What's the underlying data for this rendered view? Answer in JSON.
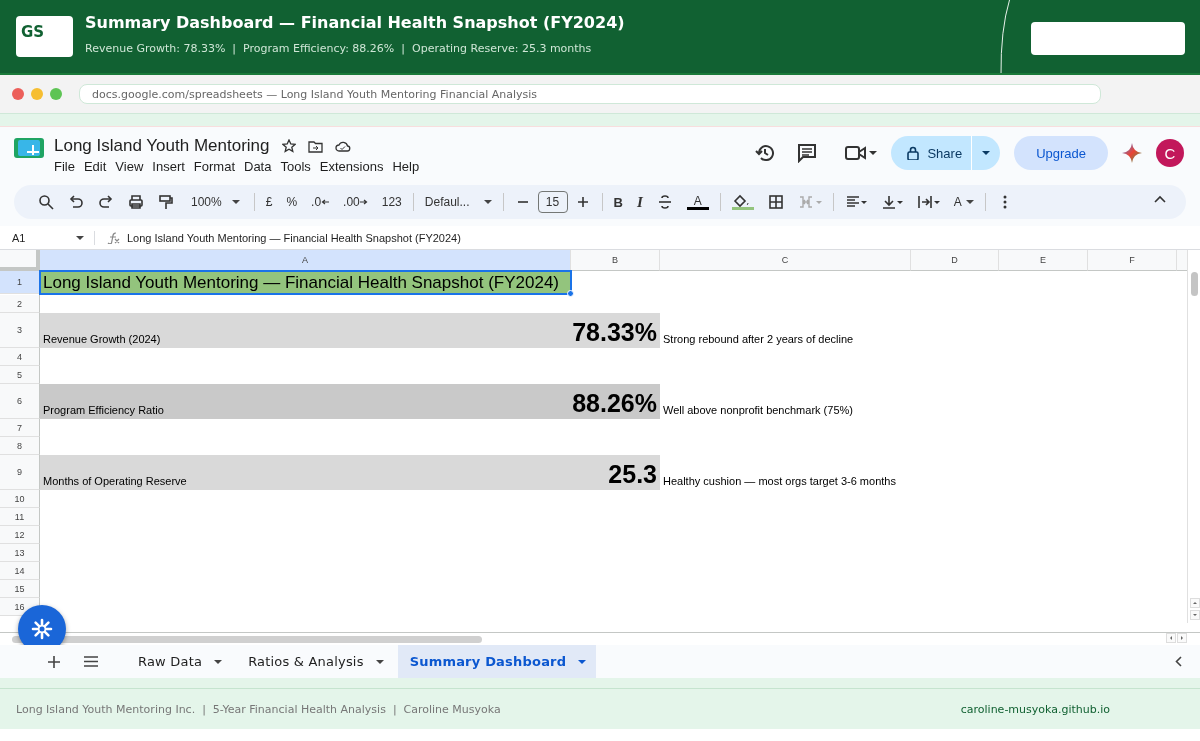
{
  "banner": {
    "logo": "GS",
    "title": "Summary Dashboard — Financial Health Snapshot (FY2024)",
    "subtitle": "Revenue Growth: 78.33%  |  Program Efficiency: 88.26%  |  Operating Reserve: 25.3 months"
  },
  "browser": {
    "url": "docs.google.com/spreadsheets — Long Island Youth Mentoring Financial Analysis"
  },
  "doc": {
    "title": "Long Island Youth Mentoring",
    "menu": [
      "File",
      "Edit",
      "View",
      "Insert",
      "Format",
      "Data",
      "Tools",
      "Extensions",
      "Help"
    ],
    "share": "Share",
    "upgrade": "Upgrade",
    "avatar": "C"
  },
  "toolbar": {
    "zoom": "100%",
    "currency": "£",
    "percent": "%",
    "decrease_decimal": ".0",
    "increase_decimal": ".00",
    "number_format": "123",
    "font": "Defaul...",
    "font_size": "15",
    "bold": "B",
    "italic": "I",
    "text_color": "A",
    "text_rotation": "A"
  },
  "name_box": "A1",
  "formula": "Long Island Youth Mentoring — Financial Health Snapshot (FY2024)",
  "columns": [
    "A",
    "B",
    "C",
    "D",
    "E",
    "F"
  ],
  "rows": [
    {
      "number": "1",
      "kind": "title",
      "text": "Long Island Youth Mentoring — Financial Health Snapshot (FY2024)",
      "selected": true
    },
    {
      "number": "2",
      "kind": "blank",
      "selected": false
    },
    {
      "number": "3",
      "kind": "metric",
      "label": "Revenue Growth (2024)",
      "value": "78.33%",
      "note": "Strong rebound after 2 years of decline",
      "color": "#d9d9d9",
      "selected": false
    },
    {
      "number": "4",
      "kind": "blank",
      "selected": false
    },
    {
      "number": "5",
      "kind": "blank",
      "selected": false
    },
    {
      "number": "6",
      "kind": "metric",
      "label": "Program Efficiency Ratio",
      "value": "88.26%",
      "note": "Well above nonprofit benchmark (75%)",
      "color": "#c9c9c9",
      "selected": false
    },
    {
      "number": "7",
      "kind": "blank",
      "selected": false
    },
    {
      "number": "8",
      "kind": "blank",
      "selected": false
    },
    {
      "number": "9",
      "kind": "metric",
      "label": "Months of Operating Reserve",
      "value": "25.3",
      "note": "Healthy cushion — most orgs target 3-6 months",
      "color": "#d9d9d9",
      "selected": false
    },
    {
      "number": "10",
      "kind": "blank",
      "selected": false
    },
    {
      "number": "11",
      "kind": "blank",
      "selected": false
    },
    {
      "number": "12",
      "kind": "blank",
      "selected": false
    },
    {
      "number": "13",
      "kind": "blank",
      "selected": false
    },
    {
      "number": "14",
      "kind": "blank",
      "selected": false
    },
    {
      "number": "15",
      "kind": "blank",
      "selected": false
    },
    {
      "number": "16",
      "kind": "blank",
      "selected": false
    }
  ],
  "sheet_tabs": [
    {
      "label": "Raw Data",
      "selected": false
    },
    {
      "label": "Ratios & Analysis",
      "selected": false
    },
    {
      "label": "Summary Dashboard",
      "selected": true
    }
  ],
  "footer": {
    "text": "Long Island Youth Mentoring Inc.  |  5-Year Financial Health Analysis  |  Caroline Musyoka",
    "link": "caroline-musyoka.github.io"
  }
}
